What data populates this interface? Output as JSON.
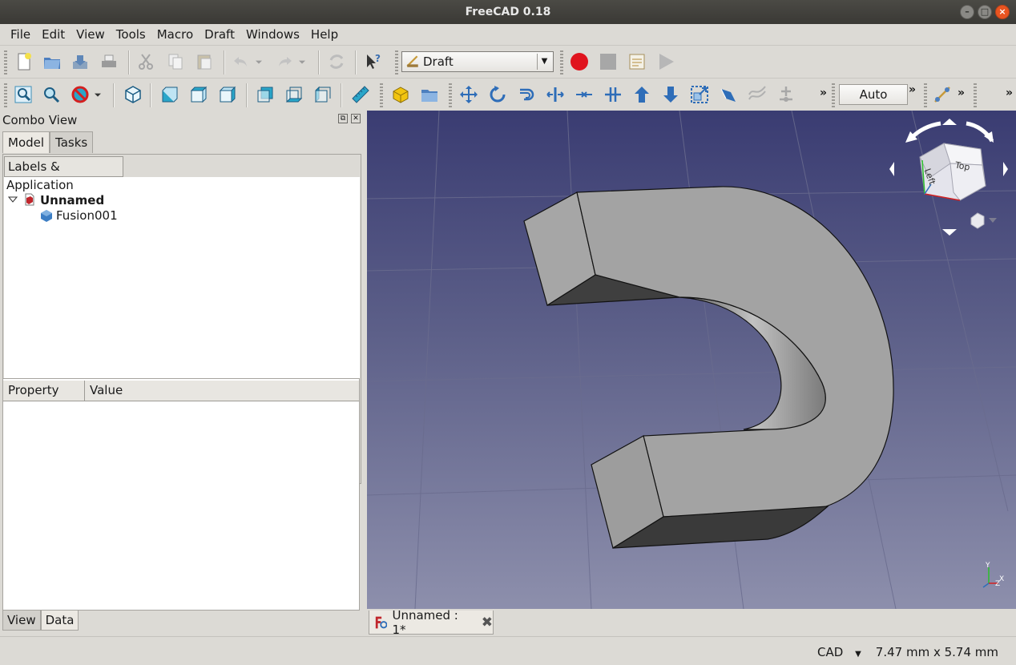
{
  "window": {
    "title": "FreeCAD 0.18"
  },
  "menu": [
    "File",
    "Edit",
    "View",
    "Tools",
    "Macro",
    "Draft",
    "Windows",
    "Help"
  ],
  "toolbar": {
    "workbench": "Draft",
    "snap_mode": "Auto",
    "overflow": "»",
    "record_color": "#e0141e",
    "part_color": "#2aa6c9"
  },
  "combo_view": {
    "title": "Combo View",
    "tabs": [
      "Model",
      "Tasks"
    ],
    "labels_header": "Labels & Attributes",
    "tree": {
      "root": "Application",
      "document": "Unnamed",
      "object": "Fusion001"
    },
    "property_columns": [
      "Property",
      "Value"
    ],
    "bottom_tabs": [
      "View",
      "Data"
    ]
  },
  "viewport": {
    "navcube": {
      "face_top": "Top",
      "face_left": "Left"
    },
    "axes": {
      "x": "X",
      "y": "Y",
      "z": "Z"
    },
    "colors": {
      "background_top": "#3a3c72",
      "background_bottom": "#8d8fac",
      "solid": "#a6a6a6"
    }
  },
  "document_tab": {
    "label": "Unnamed : 1*"
  },
  "status": {
    "nav_style": "CAD",
    "dimensions": "7.47 mm x 5.74 mm"
  }
}
